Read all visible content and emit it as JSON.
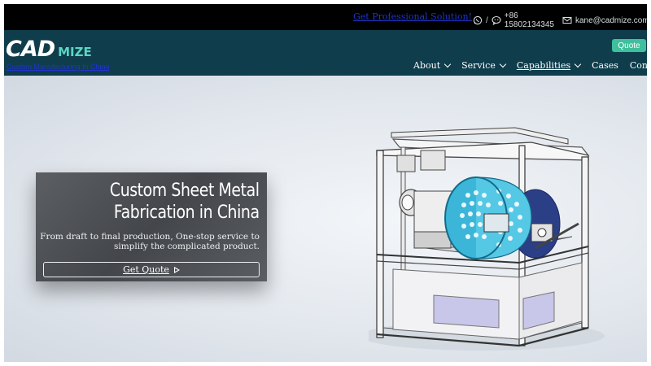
{
  "topbar": {
    "promo_link": "Get Professional Solution!",
    "phone": "+86 15802134345",
    "email": "kane@cadmize.com",
    "icons": [
      "whatsapp-icon",
      "wechat-icon",
      "mail-icon"
    ]
  },
  "nav": {
    "logo": {
      "primary": "CAD",
      "secondary": "MIZE"
    },
    "tagline": "Custom Manufacturing In China",
    "quote_button": "Quote",
    "menu": [
      {
        "label": "About",
        "dropdown": true
      },
      {
        "label": "Service",
        "dropdown": true
      },
      {
        "label": "Capabilities",
        "dropdown": true
      },
      {
        "label": "Cases",
        "dropdown": false
      },
      {
        "label": "Contact",
        "dropdown": false
      }
    ]
  },
  "hero": {
    "title_line1": "Custom Sheet Metal",
    "title_line2": "Fabrication in China",
    "subtitle_line1": "From draft to final production, One-stop service to",
    "subtitle_line2": "simplify the complicated product.",
    "cta_label": "Get Quote",
    "image_subject": "machine-cad-render"
  },
  "colors": {
    "topbar_bg": "#000000",
    "nav_bg": "#0f3d4c",
    "accent": "#3fbf9c",
    "link": "#1f35c9",
    "logo_accent": "#5bd6c3",
    "drum": "#3bb6d8"
  }
}
